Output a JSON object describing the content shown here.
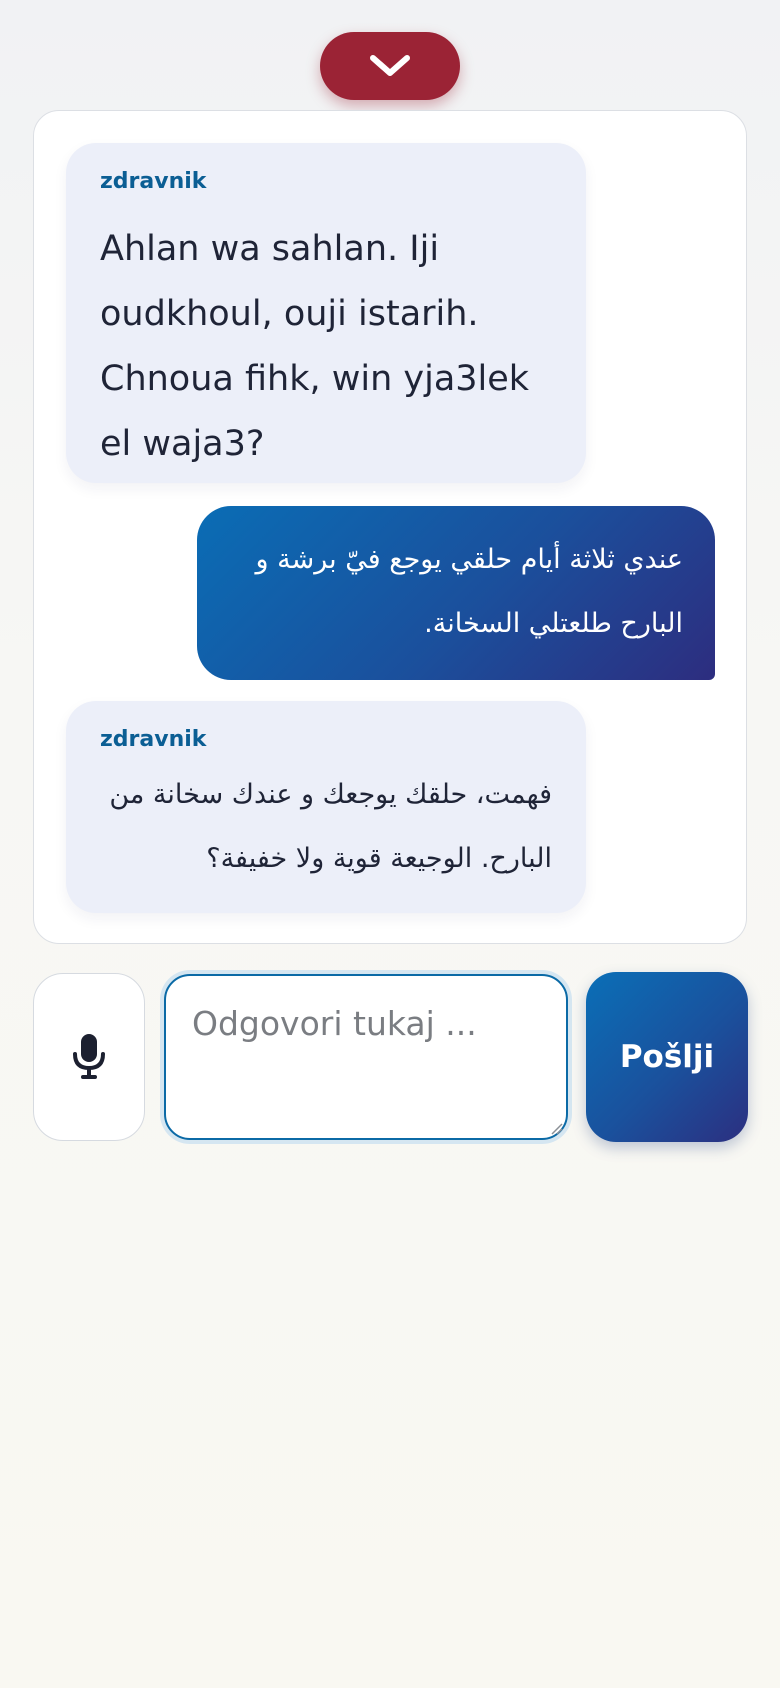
{
  "collapse": {
    "icon": "chevron-down-icon"
  },
  "messages": [
    {
      "role": "doctor",
      "sender": "zdravnik",
      "text": "Ahlan wa sahlan. Iji oudkhoul, ouji istarih. Chnoua fihk, win yja3lek el waja3?"
    },
    {
      "role": "user",
      "text": "عندي ثلاثة أيام حلقي يوجع فيّ برشة و البارح طلعتلي السخانة."
    },
    {
      "role": "doctor",
      "sender": "zdravnik",
      "text": "فهمت، حلقك يوجعك و عندك سخانة من البارح. الوجيعة قوية ولا خفيفة؟"
    }
  ],
  "composer": {
    "mic_icon": "microphone-icon",
    "placeholder": "Odgovori tukaj ...",
    "value": "",
    "send_label": "Pošlji"
  },
  "colors": {
    "accent_red": "#9b2335",
    "accent_blue": "#0b5e94",
    "bubble_doctor": "#eceff9",
    "gradient_start": "#0a6db5",
    "gradient_end": "#2d2d7f"
  }
}
